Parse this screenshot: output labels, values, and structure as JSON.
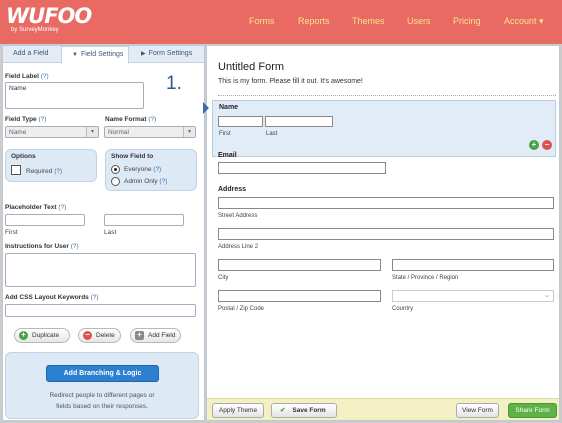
{
  "header": {
    "logo": "WUFOO",
    "logo_sub": "by SurveyMonkey",
    "nav": [
      "Forms",
      "Reports",
      "Themes",
      "Users",
      "Pricing",
      "Account"
    ],
    "account_arrow": "▾"
  },
  "tabs": [
    "Add a Field",
    "Field Settings",
    "Form Settings"
  ],
  "settings": {
    "field_number": "1.",
    "field_label_title": "Field Label",
    "field_label_value": "Name",
    "field_type_title": "Field Type",
    "field_type_value": "Name",
    "name_format_title": "Name Format",
    "name_format_value": "Normal",
    "help": "(?)",
    "options_title": "Options",
    "required_label": "Required",
    "show_field_title": "Show Field to",
    "everyone_label": "Everyone",
    "admin_only_label": "Admin Only",
    "placeholder_title": "Placeholder Text",
    "placeholder_first": "First",
    "placeholder_last": "Last",
    "instructions_title": "Instructions for User",
    "css_title": "Add CSS Layout Keywords",
    "duplicate_label": "Duplicate",
    "delete_label": "Delete",
    "add_field_label": "Add Field",
    "branching_button": "Add Branching & Logic",
    "branching_text_1": "Redirect people to different pages or",
    "branching_text_2": "fields based on their responses."
  },
  "form": {
    "title": "Untitled Form",
    "description": "This is my form. Please fill it out. It's awesome!",
    "name_label": "Name",
    "first": "First",
    "last": "Last",
    "email_label": "Email",
    "address_label": "Address",
    "street": "Street Address",
    "line2": "Address Line 2",
    "city": "City",
    "state": "State / Province / Region",
    "zip": "Postal / Zip Code",
    "country": "Country"
  },
  "footer": {
    "apply_theme": "Apply Theme",
    "save_form": "Save Form",
    "view_form": "View Form",
    "share_form": "Share Form"
  },
  "colors": {
    "header": "#e96a63",
    "nav_text": "#fbe38a",
    "accent_blue": "#2d7fd0",
    "panel_blue": "#dde9f5",
    "footer_bar": "#f3f0c4",
    "share_green": "#5fb248"
  }
}
